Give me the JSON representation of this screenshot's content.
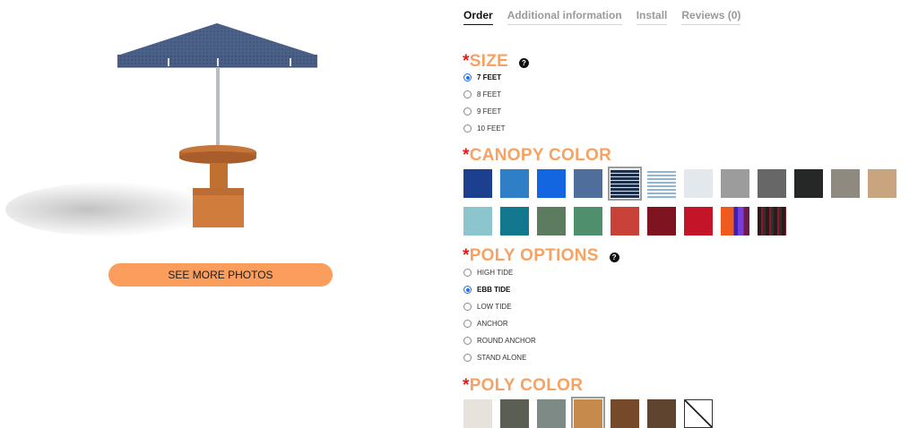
{
  "tabs": [
    {
      "label": "Order",
      "active": true
    },
    {
      "label": "Additional information",
      "active": false
    },
    {
      "label": "Install",
      "active": false
    },
    {
      "label": "Reviews (0)",
      "active": false
    }
  ],
  "product": {
    "see_more_label": "SEE MORE PHOTOS"
  },
  "size": {
    "required_mark": "*",
    "title": "SIZE",
    "help_icon": "?",
    "options": [
      {
        "label": "7 FEET",
        "selected": true
      },
      {
        "label": "8 FEET",
        "selected": false
      },
      {
        "label": "9 FEET",
        "selected": false
      },
      {
        "label": "10 FEET",
        "selected": false
      }
    ]
  },
  "canopy_color": {
    "required_mark": "*",
    "title": "CANOPY COLOR",
    "swatches": [
      {
        "color": "#1c3f8f",
        "selected": false
      },
      {
        "color": "#2f7fc6",
        "selected": false
      },
      {
        "color": "#1366e0",
        "selected": false
      },
      {
        "color": "#4f6e9c",
        "selected": false
      },
      {
        "color": "#1e2f4a",
        "selected": true,
        "pattern": "stripe-navy"
      },
      {
        "color": "#a8c8e4",
        "selected": false,
        "pattern": "stripe-light"
      },
      {
        "color": "#e3e8ec",
        "selected": false
      },
      {
        "color": "#9c9c9c",
        "selected": false
      },
      {
        "color": "#676767",
        "selected": false
      },
      {
        "color": "#262828",
        "selected": false
      },
      {
        "color": "#8f8a80",
        "selected": false
      },
      {
        "color": "#c8a47f",
        "selected": false
      },
      {
        "color": "#8dc5cf",
        "selected": false
      },
      {
        "color": "#13788d",
        "selected": false
      },
      {
        "color": "#5d7b5f",
        "selected": false
      },
      {
        "color": "#4f8f6d",
        "selected": false
      },
      {
        "color": "#c8423a",
        "selected": false
      },
      {
        "color": "#7e1420",
        "selected": false
      },
      {
        "color": "#c31428",
        "selected": false
      },
      {
        "color": "#ef5a1e",
        "selected": false,
        "pattern": "stripe-orange-purple"
      },
      {
        "color": "#2a1a1c",
        "selected": false,
        "pattern": "stripe-dark-red"
      }
    ]
  },
  "poly_options": {
    "required_mark": "*",
    "title": "POLY OPTIONS",
    "help_icon": "?",
    "options": [
      {
        "label": "HIGH TIDE",
        "selected": false
      },
      {
        "label": "EBB TIDE",
        "selected": true
      },
      {
        "label": "LOW TIDE",
        "selected": false
      },
      {
        "label": "ANCHOR",
        "selected": false
      },
      {
        "label": "ROUND ANCHOR",
        "selected": false
      },
      {
        "label": "STAND ALONE",
        "selected": false
      }
    ]
  },
  "poly_color": {
    "required_mark": "*",
    "title": "POLY COLOR",
    "swatches": [
      {
        "color": "#e7e3dc",
        "selected": false
      },
      {
        "color": "#5b5e55",
        "selected": false
      },
      {
        "color": "#7e8a86",
        "selected": false
      },
      {
        "color": "#c68a4c",
        "selected": true
      },
      {
        "color": "#76492a",
        "selected": false
      },
      {
        "color": "#5f4530",
        "selected": false
      },
      {
        "color": "#ffffff",
        "selected": false,
        "pattern": "none-slash"
      }
    ]
  },
  "colors": {
    "accent_orange": "#f7a263",
    "required_red": "#e01b1b",
    "button_orange": "#fb9d5d",
    "radio_blue": "#1a73e8"
  }
}
